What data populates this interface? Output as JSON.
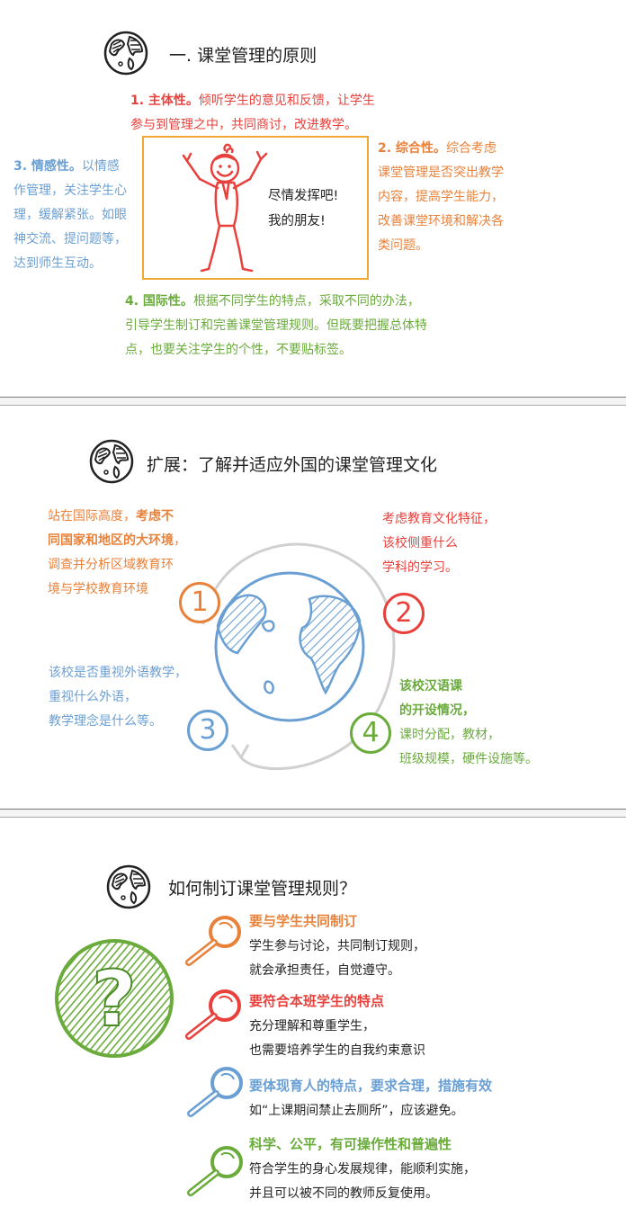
{
  "section1": {
    "title": "一.  课堂管理的原则",
    "p1_head": "1. 主体性。",
    "p1_l1": "倾听学生的意见和反馈，让学生",
    "p1_l2": "参与到管理之中，共同商讨，改进教学。",
    "p2_head": "2. 综合性。",
    "p2_l1": "综合考虑",
    "p2_l2": "课堂管理是否突出教学",
    "p2_l3": "内容，提高学生能力，",
    "p2_l4": "改善课堂环境和解决各",
    "p2_l5": "类问题。",
    "p3_head": "3. 情感性。",
    "p3_l1": "以情感",
    "p3_l2": "作管理，关注学生心",
    "p3_l3": "理，缓解紧张。如眼",
    "p3_l4": "神交流、提问题等，",
    "p3_l5": "达到师生互动。",
    "p4_head": "4. 国际性。",
    "p4_l1": "根据不同学生的特点，采取不同的办法，",
    "p4_l2": "引导学生制订和完善课堂管理规则。但既要把握总体特",
    "p4_l3": "点，也要关注学生的个性，不要贴标签。",
    "speech_l1": "尽情发挥吧!",
    "speech_l2": "我的朋友!"
  },
  "section2": {
    "title": "扩展：了解并适应外国的课堂管理文化",
    "n1": "1",
    "n2": "2",
    "n3": "3",
    "n4": "4",
    "q1_l1a": "站在国际高度，",
    "q1_l1b": "考虑不",
    "q1_l2": "同国家和地区的大环境",
    "q1_l2b": "，",
    "q1_l3": "调查并分析区域教育环",
    "q1_l4": "境与学校教育环境",
    "q2_l1": "考虑教育文化特征，",
    "q2_l2": "该校侧重什么",
    "q2_l3": "学科的学习。",
    "q3_l1": "该校是否重视外语教学，",
    "q3_l2": "重视什么外语，",
    "q3_l3": "教学理念是什么等。",
    "q4_l1": "该校汉语课",
    "q4_l2": "的开设情况，",
    "q4_l3": "课时分配，教材，",
    "q4_l4": "班级规模，硬件设施等。"
  },
  "section3": {
    "title": "如何制订课堂管理规则？",
    "r1_head": "要与学生共同制订",
    "r1_l1": "学生参与讨论，共同制订规则，",
    "r1_l2": "就会承担责任，自觉遵守。",
    "r2_head": "要符合本班学生的特点",
    "r2_l1": "充分理解和尊重学生，",
    "r2_l2": "也需要培养学生的自我约束意识",
    "r3_head": "要体现育人的特点，要求合理，措施有效",
    "r3_l1": "如“上课期间禁止去厕所”，应该避免。",
    "r4_head": "科学、公平，有可操作性和普遍性",
    "r4_l1": "符合学生的身心发展规律，能顺利实施，",
    "r4_l2": "并且可以被不同的教师反复使用。"
  },
  "colors": {
    "red": "#e8413c",
    "orange": "#e8823b",
    "blue": "#6a9fd4",
    "green": "#6aab3c",
    "box_border": "#f0a830"
  },
  "icons": [
    "globe-icon",
    "stick-figure-icon",
    "magnifier-icon",
    "question-globe-icon"
  ]
}
